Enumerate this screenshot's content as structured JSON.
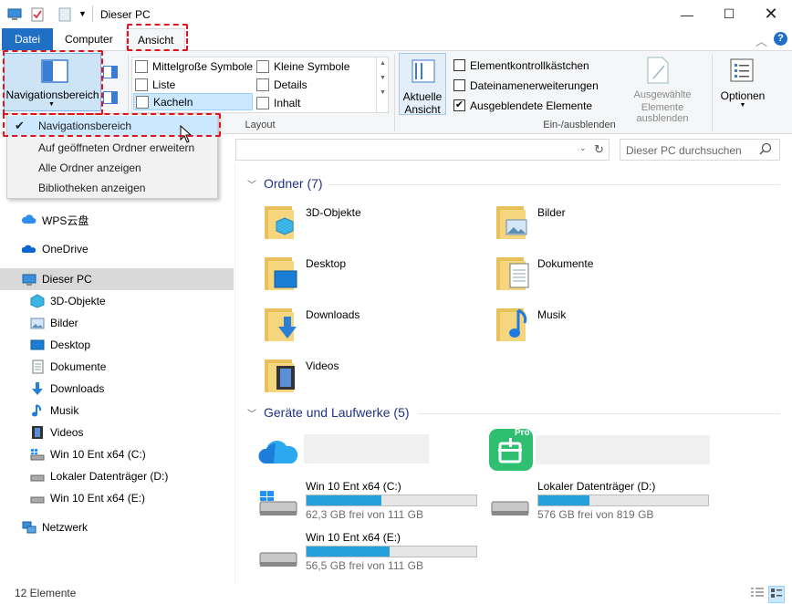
{
  "window": {
    "title": "Dieser PC"
  },
  "tabs": {
    "datei": "Datei",
    "computer": "Computer",
    "ansicht": "Ansicht"
  },
  "ribbon": {
    "nav_pane": "Navigationsbereich",
    "layout": {
      "mittel": "Mittelgroße Symbole",
      "klein": "Kleine Symbole",
      "liste": "Liste",
      "details": "Details",
      "kacheln": "Kacheln",
      "inhalt": "Inhalt",
      "group_label": "Layout"
    },
    "current_view": {
      "line1": "Aktuelle",
      "line2": "Ansicht"
    },
    "show_hide": {
      "cb1": "Elementkontrollkästchen",
      "cb2": "Dateinamenerweiterungen",
      "cb3": "Ausgeblendete Elemente",
      "hide_sel_1": "Ausgewählte",
      "hide_sel_2": "Elemente ausblenden",
      "group_label": "Ein-/ausblenden"
    },
    "options": "Optionen"
  },
  "dropdown": {
    "items": [
      "Navigationsbereich",
      "Auf geöffneten Ordner erweitern",
      "Alle Ordner anzeigen",
      "Bibliotheken anzeigen"
    ]
  },
  "search": {
    "placeholder": "Dieser PC durchsuchen"
  },
  "nav": {
    "wps": "WPS云盘",
    "onedrive": "OneDrive",
    "thispc": "Dieser PC",
    "children": [
      "3D-Objekte",
      "Bilder",
      "Desktop",
      "Dokumente",
      "Downloads",
      "Musik",
      "Videos",
      "Win 10 Ent x64 (C:)",
      "Lokaler Datenträger (D:)",
      "Win 10 Ent x64 (E:)"
    ],
    "network": "Netzwerk"
  },
  "content": {
    "folders_header": "Ordner (7)",
    "folders": [
      "3D-Objekte",
      "Bilder",
      "Desktop",
      "Dokumente",
      "Downloads",
      "Musik",
      "Videos"
    ],
    "devices_header": "Geräte und Laufwerke (5)",
    "drives": [
      {
        "name": "Win 10 Ent x64 (C:)",
        "free": "62,3 GB frei von 111 GB",
        "used_fraction": 0.44
      },
      {
        "name": "Lokaler Datenträger (D:)",
        "free": "576 GB frei von 819 GB",
        "used_fraction": 0.3
      },
      {
        "name": "Win 10 Ent x64 (E:)",
        "free": "56,5 GB frei von 111 GB",
        "used_fraction": 0.49
      }
    ],
    "pro_badge": "Pro"
  },
  "status": {
    "count": "12 Elemente"
  },
  "colors": {
    "accent": "#1f6fc5",
    "highlight": "#e0141e",
    "drive_fill": "#26a0da",
    "header": "#1e3287"
  }
}
